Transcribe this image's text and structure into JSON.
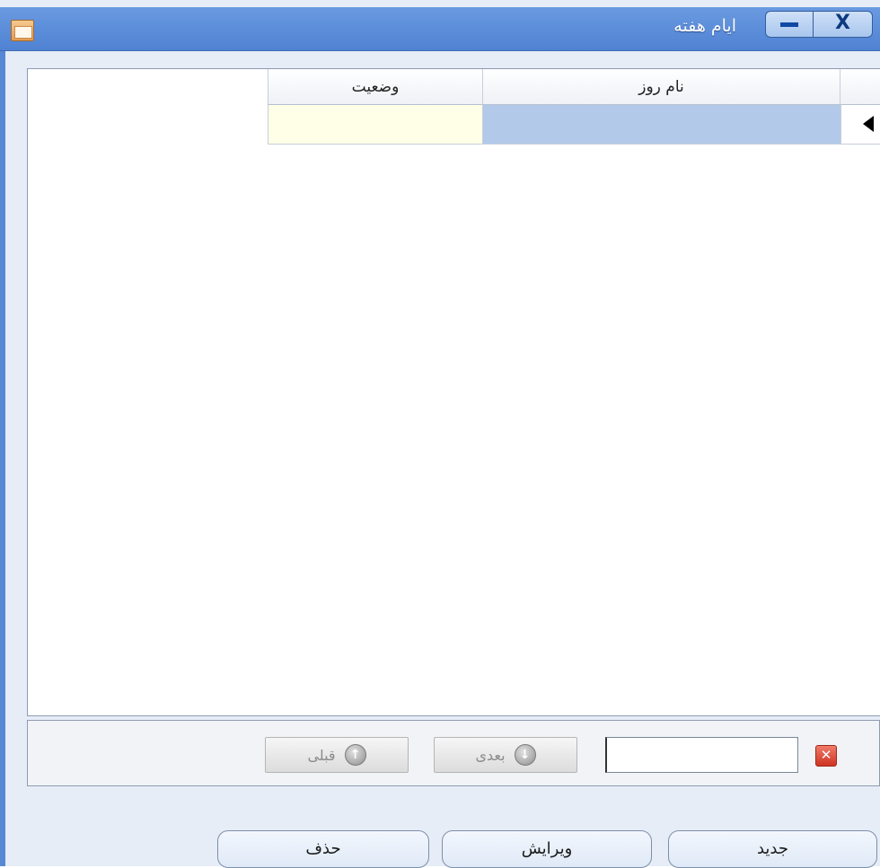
{
  "window": {
    "title": "ایام هفته",
    "close_glyph": "X"
  },
  "grid": {
    "columns": [
      "وضعیت",
      "نام روز"
    ],
    "rows": [
      {
        "status": "",
        "day_name": ""
      }
    ]
  },
  "navigation": {
    "previous_label": "قبلی",
    "next_label": "بعدی",
    "search_value": "",
    "clear_glyph": "✕"
  },
  "actions": {
    "new_label": "جدید",
    "edit_label": "ویرایش",
    "delete_label": "حذف"
  },
  "colors": {
    "titlebar": "#5788d3",
    "selected_row": "#b3c9ea",
    "status_cell": "#ffffe8"
  },
  "icons": {
    "app": "window-app-icon",
    "minimize": "minimize-icon",
    "close": "close-icon",
    "row_indicator": "row-pointer-icon",
    "previous": "arrow-up-circle-icon",
    "next": "arrow-down-circle-icon",
    "clear": "clear-search-icon"
  }
}
